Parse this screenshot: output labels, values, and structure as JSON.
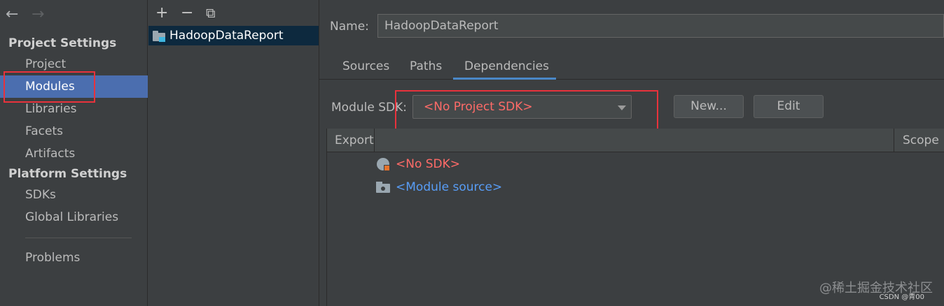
{
  "nav": {
    "back_icon": "←",
    "forward_icon": "→"
  },
  "sidebar": {
    "project_settings_title": "Project Settings",
    "project_items": [
      "Project",
      "Modules",
      "Libraries",
      "Facets",
      "Artifacts"
    ],
    "platform_settings_title": "Platform Settings",
    "platform_items": [
      "SDKs",
      "Global Libraries"
    ],
    "problems_label": "Problems",
    "selected": "Modules"
  },
  "module_list": {
    "add_icon": "+",
    "remove_icon": "−",
    "copy_icon": "⧉",
    "items": [
      "HadoopDataReport"
    ]
  },
  "detail": {
    "name_label": "Name:",
    "name_value": "HadoopDataReport",
    "tabs": [
      "Sources",
      "Paths",
      "Dependencies"
    ],
    "active_tab": "Dependencies",
    "sdk_label": "Module SDK:",
    "sdk_value": "<No Project SDK>",
    "new_button": "New...",
    "edit_button": "Edit",
    "table": {
      "col_export": "Export",
      "col_scope": "Scope",
      "rows": [
        {
          "text": "<No SDK>",
          "color": "#ff6b68",
          "icon": "sdk-globe-icon"
        },
        {
          "text": "<Module source>",
          "color": "#589df6",
          "icon": "module-folder-icon"
        }
      ]
    }
  },
  "watermark": {
    "line1": "@稀土掘金技术社区",
    "line2": "CSDN @青00"
  },
  "colors": {
    "selection": "#4b6eaf",
    "highlight_box": "#e8323c",
    "error_text": "#ff6b68",
    "link_text": "#589df6"
  }
}
